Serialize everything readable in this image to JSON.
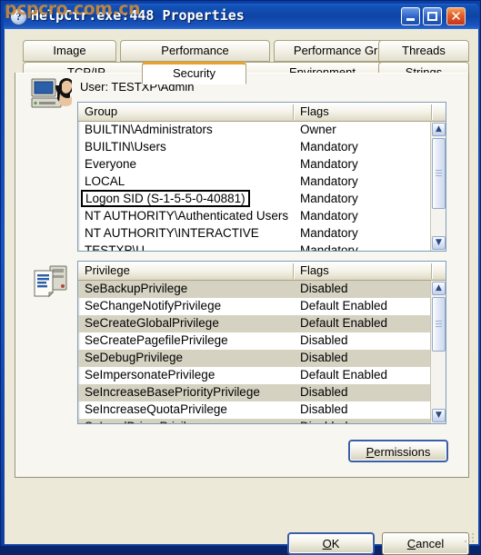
{
  "watermark": "pcpcro.com.cn",
  "window": {
    "title": "HelpCtr.exe:448 Properties",
    "title_icon": "question-mark-icon",
    "controls": {
      "minimize": "_",
      "maximize": "□",
      "close": "✕"
    }
  },
  "tabs": {
    "row1": [
      {
        "label": "Image",
        "active": false
      },
      {
        "label": "Performance",
        "active": false
      },
      {
        "label": "Performance Graph",
        "active": false
      },
      {
        "label": "Threads",
        "active": false
      }
    ],
    "row2": [
      {
        "label": "TCP/IP",
        "active": false
      },
      {
        "label": "Security",
        "active": true
      },
      {
        "label": "Environment",
        "active": false
      },
      {
        "label": "Strings",
        "active": false
      }
    ],
    "active_tab": "Security",
    "active_tab_accent": "#E8A32D"
  },
  "security": {
    "user_label": "User: TESTXP\\Admin",
    "user_icon": "user-computer-icon",
    "privileges_icon": "privileges-document-icon",
    "group_table": {
      "headers": [
        "Group",
        "Flags"
      ],
      "rows": [
        {
          "name": "BUILTIN\\Administrators",
          "flags": "Owner",
          "focused": false
        },
        {
          "name": "BUILTIN\\Users",
          "flags": "Mandatory",
          "focused": false
        },
        {
          "name": "Everyone",
          "flags": "Mandatory",
          "focused": false
        },
        {
          "name": "LOCAL",
          "flags": "Mandatory",
          "focused": false
        },
        {
          "name": "Logon SID (S-1-5-5-0-40881)",
          "flags": "Mandatory",
          "focused": true
        },
        {
          "name": "NT AUTHORITY\\Authenticated Users",
          "flags": "Mandatory",
          "focused": false
        },
        {
          "name": "NT AUTHORITY\\INTERACTIVE",
          "flags": "Mandatory",
          "focused": false
        },
        {
          "name": "TESTXP\\U",
          "flags": "Mandatory",
          "focused": false
        }
      ]
    },
    "privilege_table": {
      "headers": [
        "Privilege",
        "Flags"
      ],
      "rows": [
        {
          "name": "SeBackupPrivilege",
          "flags": "Disabled"
        },
        {
          "name": "SeChangeNotifyPrivilege",
          "flags": "Default Enabled"
        },
        {
          "name": "SeCreateGlobalPrivilege",
          "flags": "Default Enabled"
        },
        {
          "name": "SeCreatePagefilePrivilege",
          "flags": "Disabled"
        },
        {
          "name": "SeDebugPrivilege",
          "flags": "Disabled"
        },
        {
          "name": "SeImpersonatePrivilege",
          "flags": "Default Enabled"
        },
        {
          "name": "SeIncreaseBasePriorityPrivilege",
          "flags": "Disabled"
        },
        {
          "name": "SeIncreaseQuotaPrivilege",
          "flags": "Disabled"
        },
        {
          "name": "SeLoadDriverPrivilege",
          "flags": "Disabled"
        }
      ]
    }
  },
  "buttons": {
    "permissions": {
      "prefix": "",
      "accel": "P",
      "suffix": "ermissions"
    },
    "ok": {
      "prefix": "",
      "accel": "O",
      "suffix": "K"
    },
    "cancel": {
      "prefix": "",
      "accel": "C",
      "suffix": "ancel"
    }
  },
  "scrollbars": {
    "up_glyph": "▲",
    "down_glyph": "▼"
  }
}
